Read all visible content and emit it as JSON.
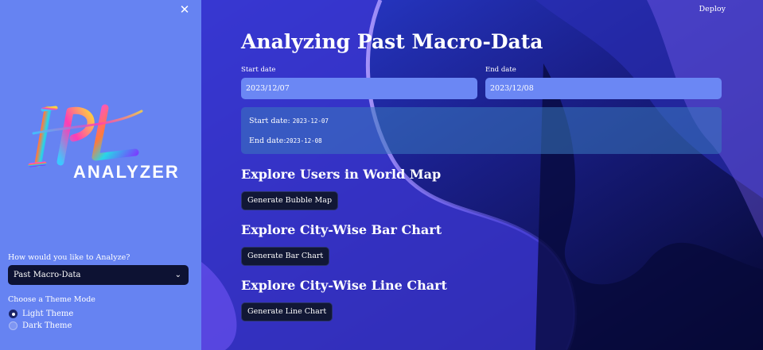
{
  "sidebar": {
    "close_icon": "close-icon",
    "logo_text": "IPL",
    "logo_subtext": "ANALYZER",
    "analyze_label": "How would you like to Analyze?",
    "analyze_selected": "Past Macro-Data",
    "theme_label": "Choose a Theme Mode",
    "theme_options": [
      "Light Theme",
      "Dark Theme"
    ],
    "theme_selected": "Light Theme"
  },
  "header": {
    "deploy_label": "Deploy"
  },
  "main": {
    "title": "Analyzing Past Macro-Data",
    "start_label": "Start date",
    "start_value": "2023/12/07",
    "end_label": "End date",
    "end_value": "2023/12/08",
    "info": {
      "start_prefix": "Start date: ",
      "start_value": "2023-12-07",
      "end_prefix": "End date:",
      "end_value": "2023-12-08"
    },
    "sections": [
      {
        "heading": "Explore Users in World Map",
        "button": "Generate Bubble Map"
      },
      {
        "heading": "Explore City-Wise Bar Chart",
        "button": "Generate Bar Chart"
      },
      {
        "heading": "Explore City-Wise Line Chart",
        "button": "Generate Line Chart"
      }
    ]
  },
  "colors": {
    "sidebar_bg": "#6683f2",
    "main_bg": "#0c0f4a",
    "button_bg": "#111735",
    "input_bg": "#6b87f4"
  }
}
